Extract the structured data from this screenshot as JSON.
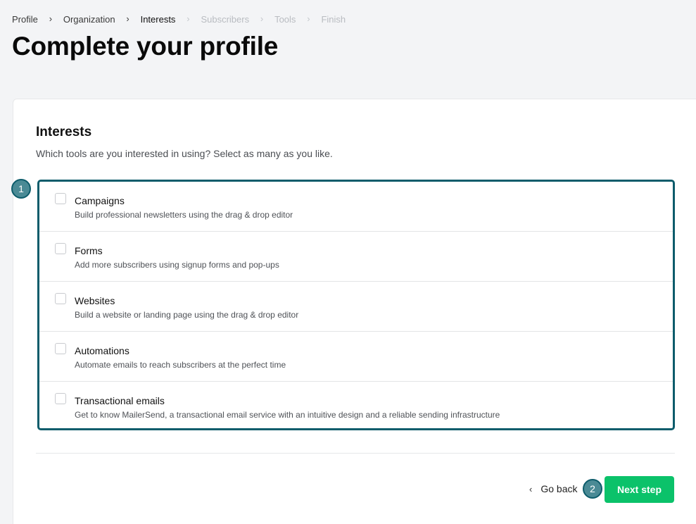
{
  "breadcrumb": [
    {
      "label": "Profile",
      "state": "done"
    },
    {
      "label": "Organization",
      "state": "done"
    },
    {
      "label": "Interests",
      "state": "active"
    },
    {
      "label": "Subscribers",
      "state": "disabled"
    },
    {
      "label": "Tools",
      "state": "disabled"
    },
    {
      "label": "Finish",
      "state": "disabled"
    }
  ],
  "page_title": "Complete your profile",
  "section": {
    "title": "Interests",
    "description": "Which tools are you interested in using? Select as many as you like."
  },
  "options": [
    {
      "title": "Campaigns",
      "description": "Build professional newsletters using the drag & drop editor",
      "checked": false
    },
    {
      "title": "Forms",
      "description": "Add more subscribers using signup forms and pop-ups",
      "checked": false
    },
    {
      "title": "Websites",
      "description": "Build a website or landing page using the drag & drop editor",
      "checked": false
    },
    {
      "title": "Automations",
      "description": "Automate emails to reach subscribers at the perfect time",
      "checked": false
    },
    {
      "title": "Transactional emails",
      "description": "Get to know MailerSend, a transactional email service with an intuitive design and a reliable sending infrastructure",
      "checked": false
    }
  ],
  "callouts": [
    "1",
    "2"
  ],
  "actions": {
    "go_back_label": "Go back",
    "next_label": "Next step"
  },
  "colors": {
    "accent": "#0d5c6b",
    "primary_button": "#0bc26a",
    "background": "#f3f4f6"
  },
  "icons": {
    "breadcrumb_separator": "chevron-right-icon",
    "go_back": "chevron-left-icon"
  }
}
